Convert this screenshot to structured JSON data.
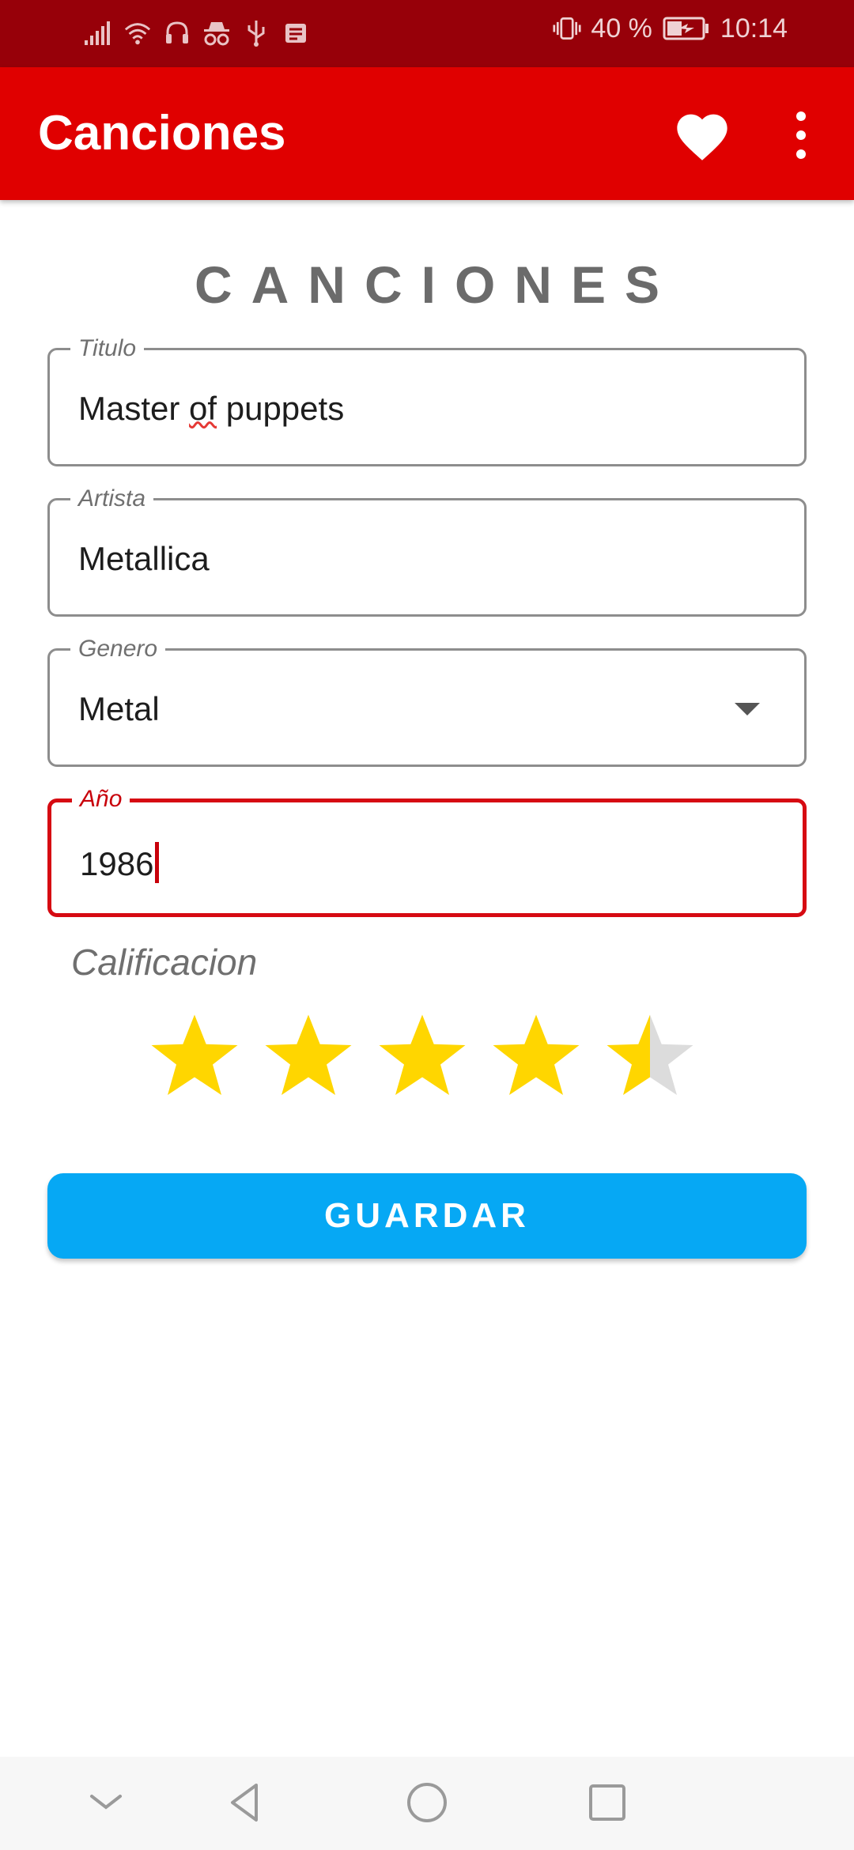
{
  "status_bar": {
    "battery": "40 %",
    "time": "10:14",
    "icons": [
      "signal-icon",
      "wifi-icon",
      "headset-icon",
      "incognito-icon",
      "usb-icon",
      "notification-icon",
      "vibrate-icon",
      "battery-charging-icon"
    ]
  },
  "app_bar": {
    "title": "Canciones",
    "actions": [
      "favorite-icon",
      "more-vert-icon"
    ]
  },
  "form": {
    "heading": "CANCIONES",
    "titulo": {
      "label": "Titulo",
      "value_words": [
        "Master",
        "of",
        "puppets"
      ]
    },
    "artista": {
      "label": "Artista",
      "value": "Metallica"
    },
    "genero": {
      "label": "Genero",
      "value": "Metal"
    },
    "anio": {
      "label": "Año",
      "value": "1986"
    },
    "rating": {
      "label": "Calificacion",
      "value": 4.5,
      "max": 5
    },
    "save_label": "GUARDAR"
  },
  "colors": {
    "status_bar": "#970009",
    "app_bar": "#e00000",
    "accent": "#d60a12",
    "button": "#06a8f4",
    "star_filled": "#ffd600",
    "star_empty": "#dcdcdc"
  },
  "nav_bar": [
    "collapse-icon",
    "back-icon",
    "home-icon",
    "recents-icon"
  ]
}
